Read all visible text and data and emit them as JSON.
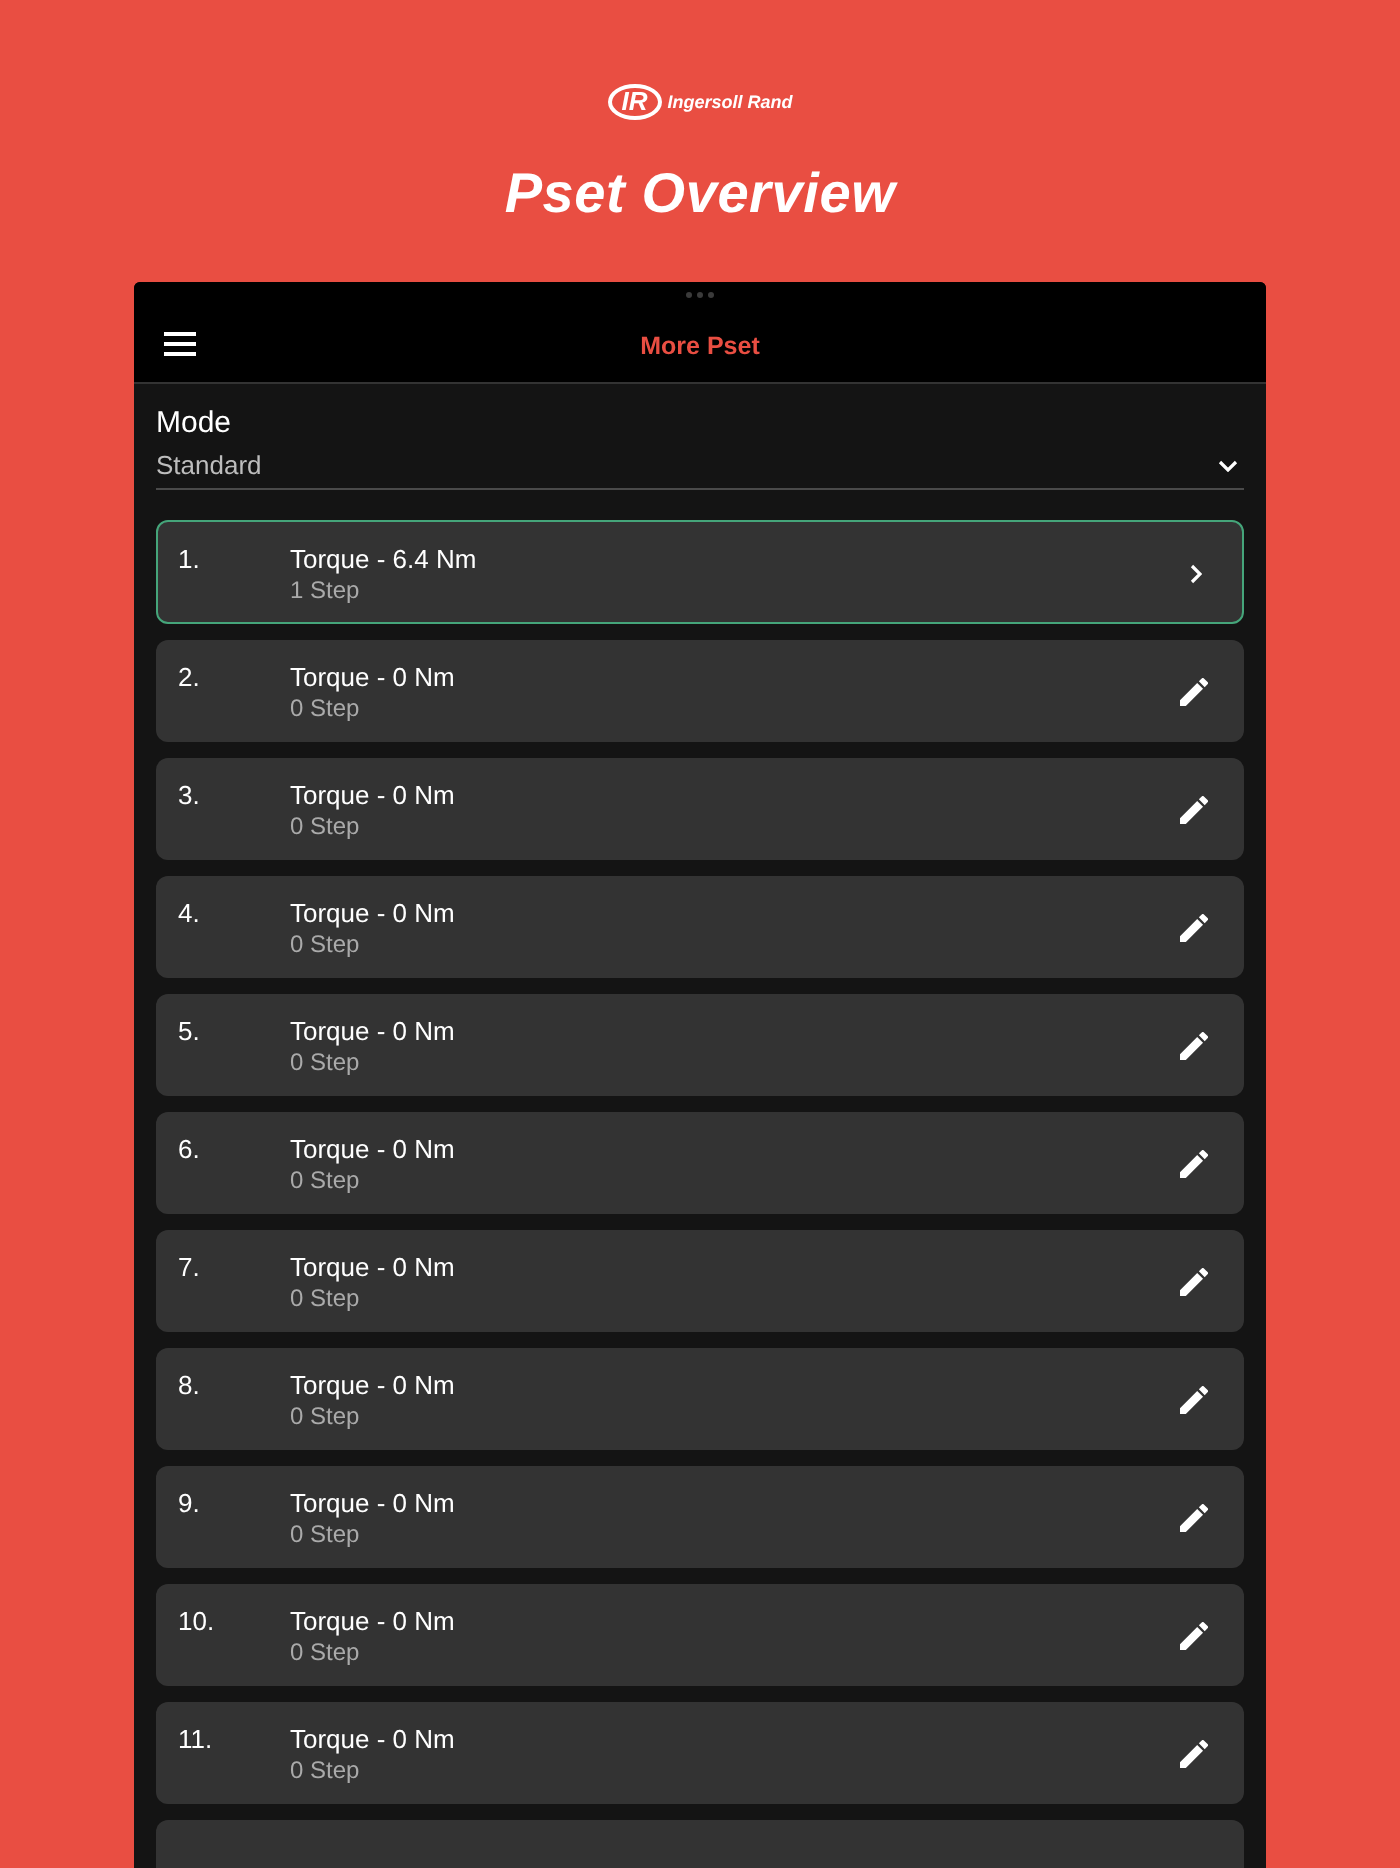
{
  "brand": {
    "monogram": "IR",
    "name": "Ingersoll Rand"
  },
  "title": "Pset Overview",
  "app_bar": {
    "title": "More Pset"
  },
  "mode": {
    "label": "Mode",
    "value": "Standard"
  },
  "psets": [
    {
      "number": "1.",
      "title": "Torque - 6.4 Nm",
      "steps": "1 Step",
      "selected": true,
      "kind": "open"
    },
    {
      "number": "2.",
      "title": "Torque - 0 Nm",
      "steps": "0 Step",
      "selected": false,
      "kind": "edit"
    },
    {
      "number": "3.",
      "title": "Torque - 0 Nm",
      "steps": "0 Step",
      "selected": false,
      "kind": "edit"
    },
    {
      "number": "4.",
      "title": "Torque - 0 Nm",
      "steps": "0 Step",
      "selected": false,
      "kind": "edit"
    },
    {
      "number": "5.",
      "title": "Torque - 0 Nm",
      "steps": "0 Step",
      "selected": false,
      "kind": "edit"
    },
    {
      "number": "6.",
      "title": "Torque - 0 Nm",
      "steps": "0 Step",
      "selected": false,
      "kind": "edit"
    },
    {
      "number": "7.",
      "title": "Torque - 0 Nm",
      "steps": "0 Step",
      "selected": false,
      "kind": "edit"
    },
    {
      "number": "8.",
      "title": "Torque - 0 Nm",
      "steps": "0 Step",
      "selected": false,
      "kind": "edit"
    },
    {
      "number": "9.",
      "title": "Torque - 0 Nm",
      "steps": "0 Step",
      "selected": false,
      "kind": "edit"
    },
    {
      "number": "10.",
      "title": "Torque - 0 Nm",
      "steps": "0 Step",
      "selected": false,
      "kind": "edit"
    },
    {
      "number": "11.",
      "title": "Torque - 0 Nm",
      "steps": "0 Step",
      "selected": false,
      "kind": "edit"
    }
  ]
}
